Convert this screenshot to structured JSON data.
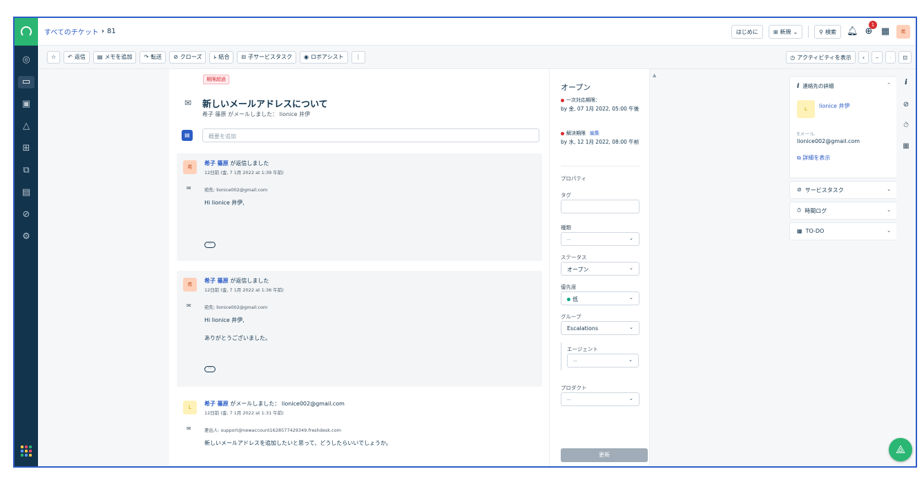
{
  "breadcrumb": {
    "all_tickets": "すべてのチケット",
    "ticket_id": "81"
  },
  "topbar": {
    "getting_started": "はじめに",
    "new": "新規",
    "search": "検索",
    "notification_count": "1",
    "user_initial": "希"
  },
  "actions": {
    "reply": "返信",
    "add_note": "メモを追加",
    "forward": "転送",
    "close": "クローズ",
    "merge": "結合",
    "child_task": "子サービスタスク",
    "robo_assist": "ロボアシスト",
    "show_activity": "アクティビティを表示"
  },
  "ticket": {
    "overdue_tag": "期限超過",
    "subject": "新しいメールアドレスについて",
    "sub_line": "希子 篠原 がメールしました： lionice 井伊",
    "summary_placeholder": "概要を追加"
  },
  "replies": [
    {
      "avatar": "希",
      "author": "希子 篠原",
      "action": " が返信しました",
      "time": "12日前 (金, 7 1月 2022 at 1:39 午前)",
      "to": "宛先: lionice002@gmail.com",
      "body1": "Hi lionice 井伊,",
      "body2": ""
    },
    {
      "avatar": "希",
      "author": "希子 篠原",
      "action": " が返信しました",
      "time": "12日前 (金, 7 1月 2022 at 1:36 午前)",
      "to": "宛先: lionice002@gmail.com",
      "body1": "Hi lionice 井伊,",
      "body2": "ありがとうございました。"
    },
    {
      "avatar": "L",
      "author": "希子 篠原",
      "action": " がメールしました： lionice002@gmail.com",
      "time": "12日前 (金, 7 1月 2022 at 1:31 午前)",
      "to": "差出人: support@newaccount1628577429349.freshdesk.com",
      "body1": "新しいメールアドレスを追加したいと思って、どうしたらいいでしょうか。",
      "body2": ""
    }
  ],
  "properties": {
    "status_title": "オープン",
    "first_response_label": "一次対応期限：",
    "first_response_value": "by 金, 07 1月 2022, 05:00 午後",
    "resolution_label": "解決期限",
    "resolution_edit": "編集",
    "resolution_value": "by 水, 12 1月 2022, 08:00 午前",
    "section": "プロパティ",
    "tag_label": "タグ",
    "type_label": "種類",
    "type_value": "--",
    "status_label": "ステータス",
    "status_value": "オープン",
    "priority_label": "優先度",
    "priority_value": "低",
    "group_label": "グループ",
    "group_value": "Escalations",
    "agent_label": "エージェント",
    "agent_value": "--",
    "product_label": "プロダクト",
    "product_value": "--",
    "update": "更新"
  },
  "contact": {
    "title": "連絡先の詳細",
    "avatar": "L",
    "name": "lionice 井伊",
    "email_label": "Eメール",
    "email": "lionice002@gmail.com",
    "view_details": "詳細を表示"
  },
  "accordions": {
    "service_tasks": "サービスタスク",
    "time_log": "時間ログ",
    "todo": "TO-DO"
  },
  "colors": {
    "brand_green": "#2bb673",
    "nav_dark": "#12344d",
    "link_blue": "#2c5cc5",
    "overdue_red": "#d72d30"
  }
}
